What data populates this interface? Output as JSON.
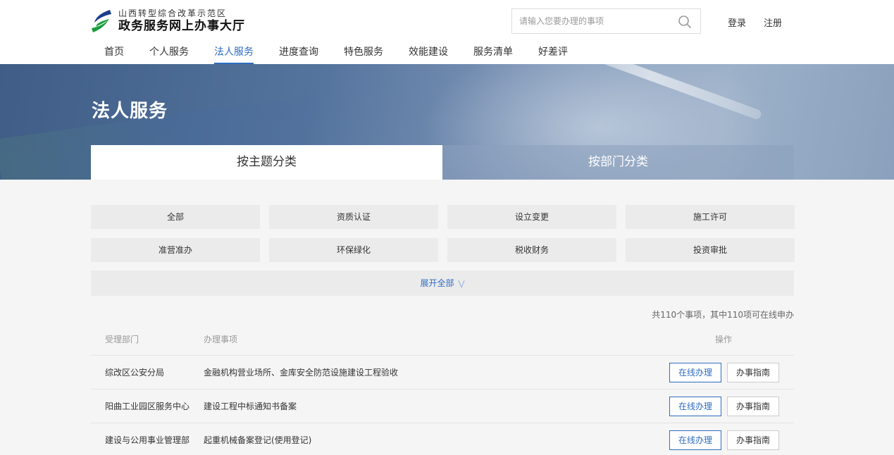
{
  "logo": {
    "subtitle": "山西转型综合改革示范区",
    "title": "政务服务网上办事大厅",
    "colors": {
      "green": "#1a9c3e",
      "blue": "#1b3f8f"
    },
    "icon": "logo-mark"
  },
  "search": {
    "placeholder": "请输入您要办理的事项",
    "value": "",
    "icon": "search-icon"
  },
  "auth": {
    "login": "登录",
    "register": "注册"
  },
  "nav": {
    "items": [
      {
        "label": "首页"
      },
      {
        "label": "个人服务"
      },
      {
        "label": "法人服务",
        "active": true
      },
      {
        "label": "进度查询"
      },
      {
        "label": "特色服务"
      },
      {
        "label": "效能建设"
      },
      {
        "label": "服务清单"
      },
      {
        "label": "好差评"
      }
    ]
  },
  "banner": {
    "title": "法人服务"
  },
  "category_tabs": [
    {
      "label": "按主题分类",
      "active": true
    },
    {
      "label": "按部门分类",
      "active": false
    }
  ],
  "topics": [
    "全部",
    "资质认证",
    "设立变更",
    "施工许可",
    "准营准办",
    "环保绿化",
    "税收财务",
    "投资审批"
  ],
  "expand": {
    "label": "展开全部",
    "icon": "chevron-double-down-icon"
  },
  "summary": "共110个事项，其中110项可在线申办",
  "table": {
    "headers": {
      "dept": "受理部门",
      "item": "办理事项",
      "op": "操作"
    },
    "rows": [
      {
        "dept": "综改区公安分局",
        "item": "金融机构营业场所、金库安全防范设施建设工程验收",
        "online": "在线办理",
        "guide": "办事指南"
      },
      {
        "dept": "阳曲工业园区服务中心",
        "item": "建设工程中标通知书备案",
        "online": "在线办理",
        "guide": "办事指南"
      },
      {
        "dept": "建设与公用事业管理部",
        "item": "起重机械备案登记(使用登记)",
        "online": "在线办理",
        "guide": "办事指南"
      }
    ]
  },
  "accent_color": "#2d6cc0"
}
